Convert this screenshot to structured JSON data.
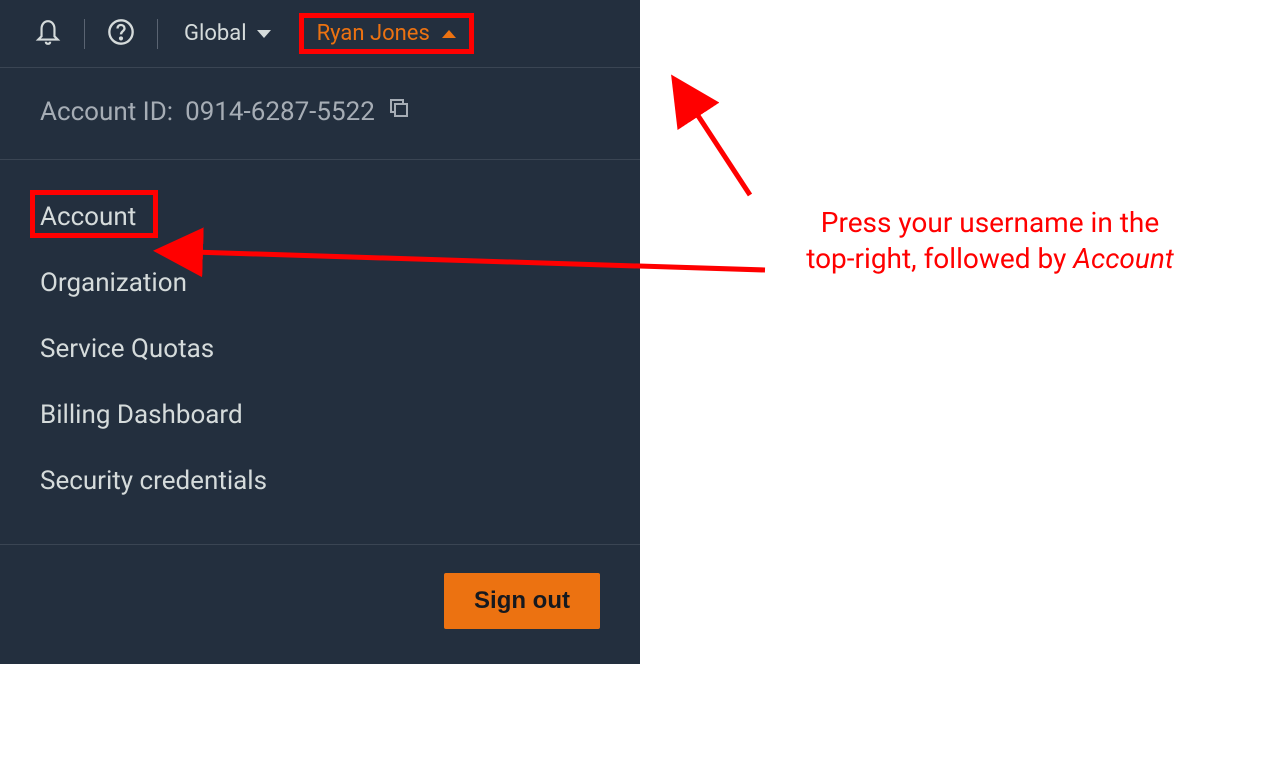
{
  "header": {
    "region_label": "Global",
    "username": "Ryan Jones"
  },
  "account": {
    "id_label": "Account ID:",
    "id_value": "0914-6287-5522"
  },
  "menu": {
    "items": [
      "Account",
      "Organization",
      "Service Quotas",
      "Billing Dashboard",
      "Security credentials"
    ],
    "signout_label": "Sign out"
  },
  "annotation": {
    "text_line1": "Press your username in the",
    "text_line2_prefix": "top-right, followed by ",
    "text_line2_em": "Account"
  }
}
